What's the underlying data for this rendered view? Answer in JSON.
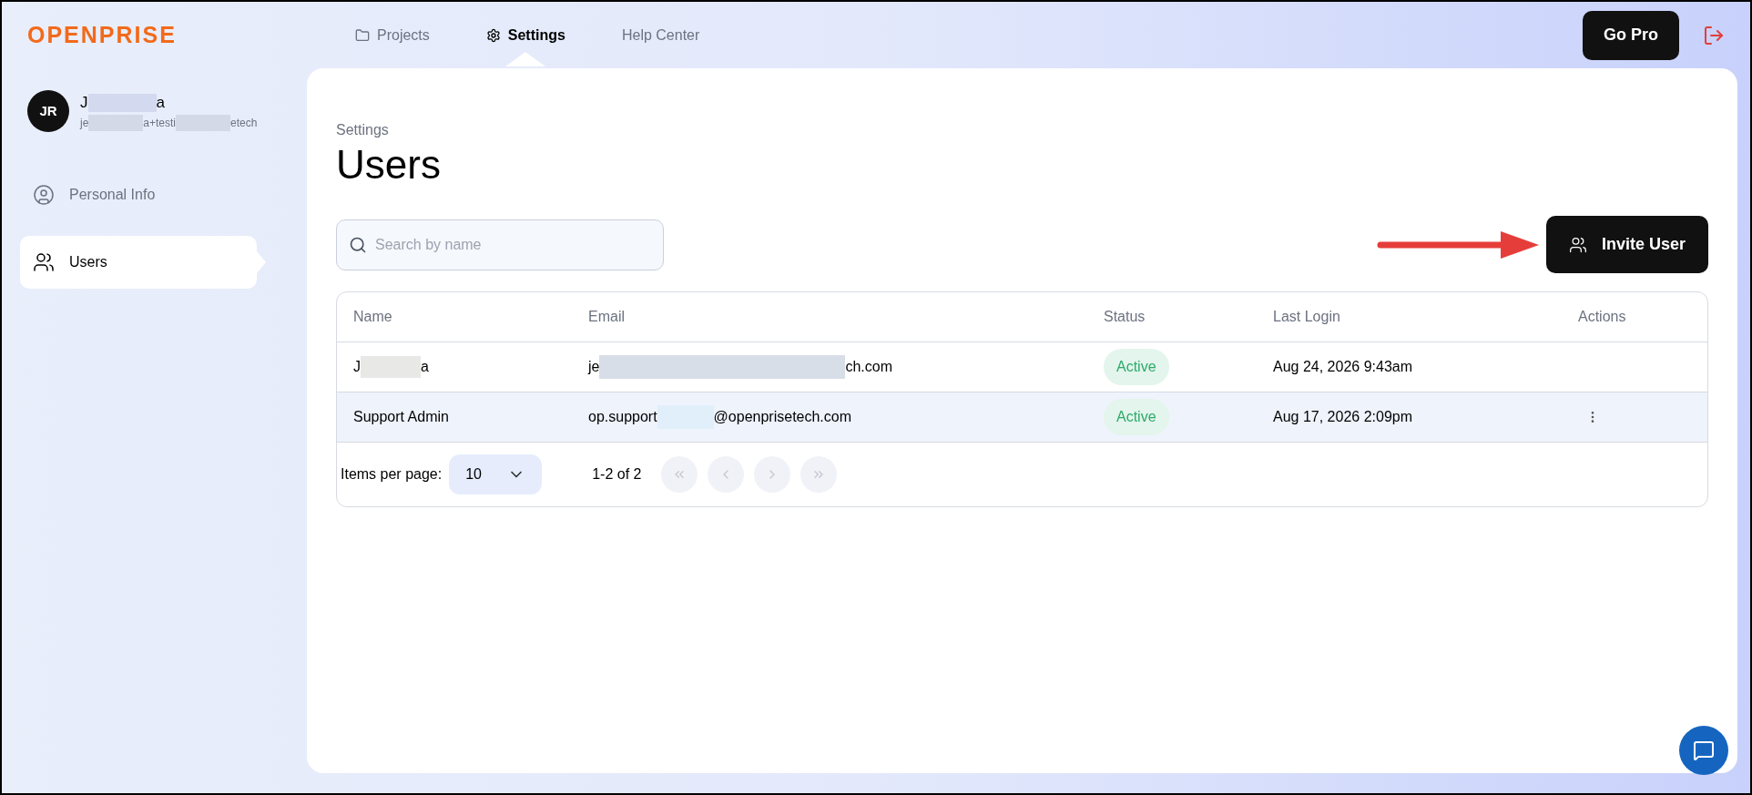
{
  "header": {
    "logo": "OPENPRISE",
    "nav": [
      {
        "label": "Projects",
        "selected": false
      },
      {
        "label": "Settings",
        "selected": true
      },
      {
        "label": "Help Center",
        "selected": false
      }
    ],
    "go_pro": "Go Pro"
  },
  "profile": {
    "initials": "JR",
    "name_parts": [
      "J",
      "a"
    ],
    "email_parts": [
      "je",
      "a+testi",
      "etech"
    ]
  },
  "sidebar": {
    "items": [
      {
        "label": "Personal Info",
        "selected": false
      },
      {
        "label": "Users",
        "selected": true
      }
    ]
  },
  "page": {
    "breadcrumb": "Settings",
    "title": "Users",
    "search": {
      "placeholder": "Search by name"
    },
    "invite_button": "Invite User"
  },
  "table": {
    "columns": [
      "Name",
      "Email",
      "Status",
      "Last Login",
      "Actions"
    ],
    "rows": [
      {
        "name_parts": [
          "J",
          "a"
        ],
        "email_parts": [
          "je",
          "ch.com"
        ],
        "status": "Active",
        "last_login": "Aug 24, 2026 9:43am",
        "has_actions": false,
        "highlighted": false
      },
      {
        "name_parts": [
          "Support Admin"
        ],
        "email_parts": [
          "op.support",
          "@openprisetech.com"
        ],
        "status": "Active",
        "last_login": "Aug 17, 2026 2:09pm",
        "has_actions": true,
        "highlighted": true
      }
    ]
  },
  "pagination": {
    "label": "Items per page:",
    "page_size": "10",
    "range": "1-2 of 2"
  }
}
